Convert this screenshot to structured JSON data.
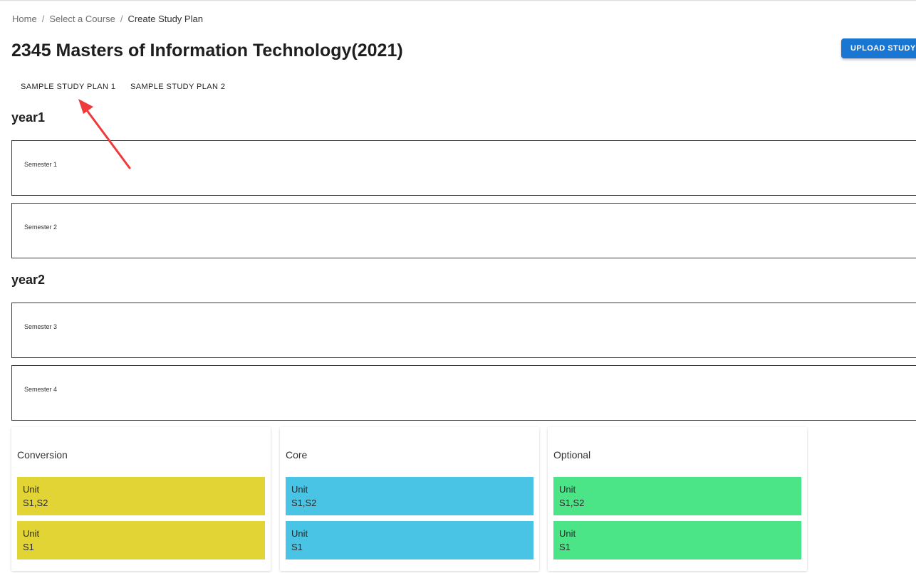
{
  "breadcrumb": {
    "home": "Home",
    "select_course": "Select a Course",
    "current": "Create Study Plan",
    "separator": "/"
  },
  "page_title": "2345 Masters of Information Technology(2021)",
  "upload_button": "UPLOAD STUDY PLAN",
  "tabs": [
    "SAMPLE STUDY PLAN 1",
    "SAMPLE STUDY PLAN 2"
  ],
  "years": [
    {
      "title": "year1",
      "semesters": [
        "Semester 1",
        "Semester 2"
      ]
    },
    {
      "title": "year2",
      "semesters": [
        "Semester 3",
        "Semester 4"
      ]
    }
  ],
  "unit_groups": [
    {
      "title": "Conversion",
      "color": "#e2d434",
      "units": [
        {
          "name": "Unit",
          "offered": "S1,S2"
        },
        {
          "name": "Unit",
          "offered": "S1"
        }
      ]
    },
    {
      "title": "Core",
      "color": "#4ac4e4",
      "units": [
        {
          "name": "Unit",
          "offered": "S1,S2"
        },
        {
          "name": "Unit",
          "offered": "S1"
        }
      ]
    },
    {
      "title": "Optional",
      "color": "#4be487",
      "units": [
        {
          "name": "Unit",
          "offered": "S1,S2"
        },
        {
          "name": "Unit",
          "offered": "S1"
        }
      ]
    }
  ],
  "colors": {
    "primary_button": "#1976d2",
    "annotation_arrow": "#ee3a3a"
  },
  "icons": {
    "annotation": "red-arrow-icon"
  }
}
